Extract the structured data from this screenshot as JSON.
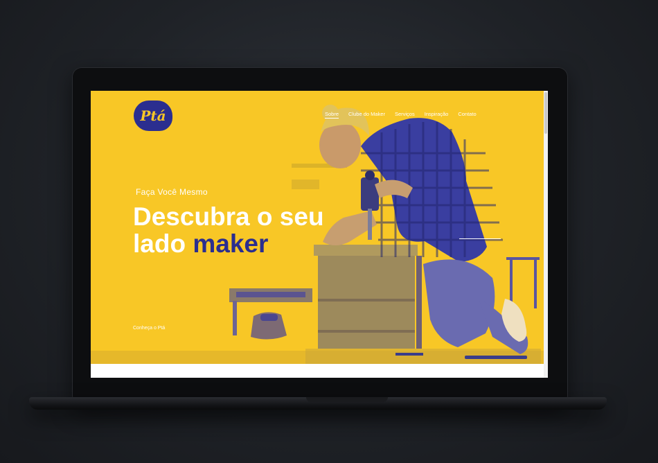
{
  "brand": {
    "logo_text": "Ptá",
    "primary_color": "#2b2e8f",
    "accent_color": "#f8c726"
  },
  "nav": {
    "items": [
      {
        "label": "Sobre"
      },
      {
        "label": "Clube do Maker"
      },
      {
        "label": "Serviços"
      },
      {
        "label": "Inspiração"
      },
      {
        "label": "Contato"
      }
    ]
  },
  "hero": {
    "eyebrow": "Faça Você Mesmo",
    "headline_line1": "Descubra o seu",
    "headline_line2_prefix": "lado ",
    "headline_line2_accent": "maker",
    "cta": "Conheça o Ptá"
  }
}
